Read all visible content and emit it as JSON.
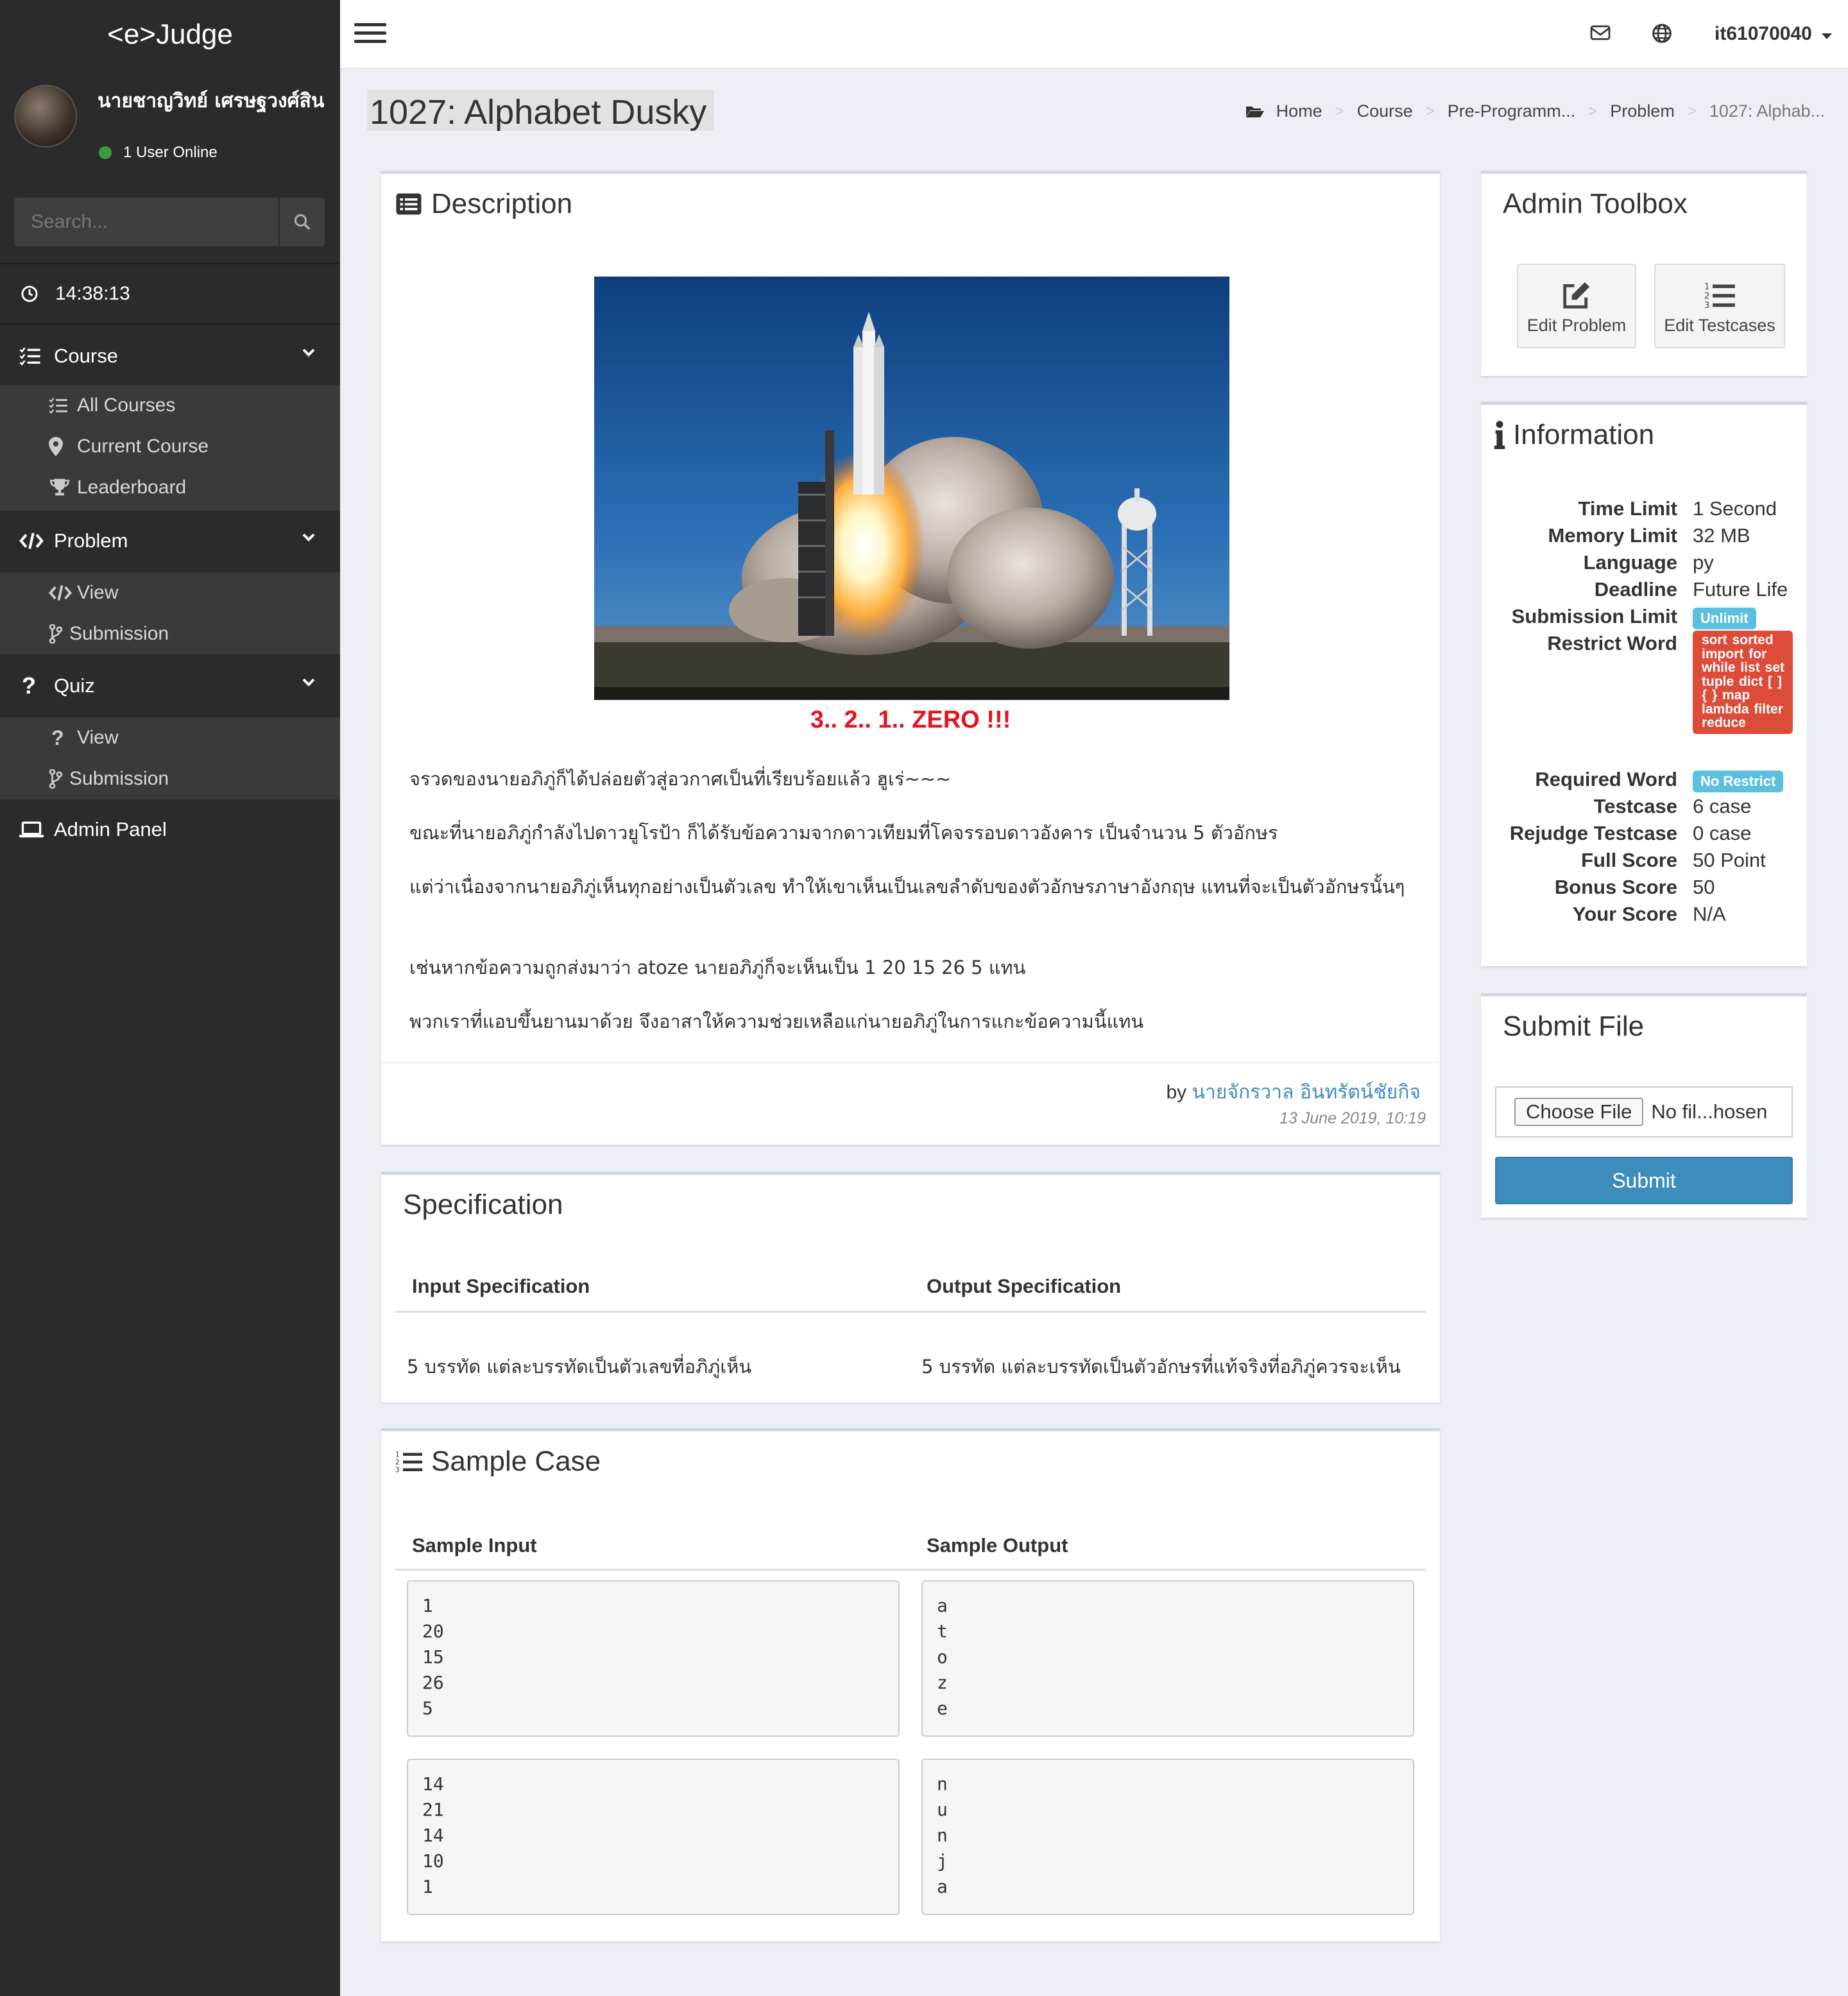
{
  "app": {
    "brand": "<e>Judge"
  },
  "user": {
    "name": "นายชาญวิทย์ เศรษฐวงศ์สิน",
    "status": "1 User Online",
    "menu_user": "it61070040"
  },
  "sidebar": {
    "search_placeholder": "Search...",
    "clock": "14:38:13",
    "course": {
      "label": "Course",
      "items": [
        "All Courses",
        "Current Course",
        "Leaderboard"
      ]
    },
    "problem": {
      "label": "Problem",
      "items": [
        "View",
        "Submission"
      ]
    },
    "quiz": {
      "label": "Quiz",
      "items": [
        "View",
        "Submission"
      ]
    },
    "admin": "Admin Panel"
  },
  "page": {
    "title": "1027: Alphabet Dusky",
    "breadcrumb": [
      "Home",
      "Course",
      "Pre-Programm...",
      "Problem",
      "1027: Alphab..."
    ]
  },
  "description": {
    "title": "Description",
    "caption": "3.. 2.. 1.. ZERO !!!",
    "paragraphs": [
      "จรวดของนายอภิภู่ก็ได้ปล่อยตัวสู่อวกาศเป็นที่เรียบร้อยแล้ว ฮูเร่~~~",
      "ขณะที่นายอภิภู่กำลังไปดาวยูโรป้า ก็ได้รับข้อความจากดาวเทียมที่โคจรรอบดาวอังคาร เป็นจำนวน 5 ตัวอักษร",
      "แต่ว่าเนื่องจากนายอภิภู่เห็นทุกอย่างเป็นตัวเลข ทำให้เขาเห็นเป็นเลขลำดับของตัวอักษรภาษาอังกฤษ แทนที่จะเป็นตัวอักษรนั้นๆ",
      "เช่นหากข้อความถูกส่งมาว่า atoze นายอภิภู่ก็จะเห็นเป็น 1 20 15 26 5 แทน",
      "พวกเราที่แอบขึ้นยานมาด้วย จึงอาสาให้ความช่วยเหลือแก่นายอภิภู่ในการแกะข้อความนี้แทน"
    ],
    "by_prefix": "by ",
    "author": "นายจักรวาล อินทรัตน์ชัยกิจ",
    "date": "13 June 2019, 10:19"
  },
  "specification": {
    "title": "Specification",
    "input_header": "Input Specification",
    "output_header": "Output Specification",
    "input": "5 บรรทัด แต่ละบรรทัดเป็นตัวเลขที่อภิภู่เห็น",
    "output": "5 บรรทัด แต่ละบรรทัดเป็นตัวอักษรที่แท้จริงที่อภิภู่ควรจะเห็น"
  },
  "sample": {
    "title": "Sample Case",
    "input_header": "Sample Input",
    "output_header": "Sample Output",
    "cases": [
      {
        "input": "1\n20\n15\n26\n5",
        "output": "a\nt\no\nz\ne"
      },
      {
        "input": "14\n21\n14\n10\n1",
        "output": "n\nu\nn\nj\na"
      }
    ]
  },
  "toolbox": {
    "title": "Admin Toolbox",
    "edit_problem": "Edit Problem",
    "edit_testcases": "Edit Testcases"
  },
  "information": {
    "title": "Information",
    "time_limit": {
      "label": "Time Limit",
      "value": "1 Second"
    },
    "memory_limit": {
      "label": "Memory Limit",
      "value": "32 MB"
    },
    "language": {
      "label": "Language",
      "value": "py"
    },
    "deadline": {
      "label": "Deadline",
      "value": "Future Life"
    },
    "submission_limit": {
      "label": "Submission Limit",
      "value": "Unlimit"
    },
    "restrict_word": {
      "label": "Restrict Word",
      "value": "sort sorted import for while list set tuple dict [ ] { } map lambda filter reduce"
    },
    "required_word": {
      "label": "Required Word",
      "value": "No Restrict"
    },
    "testcase": {
      "label": "Testcase",
      "value": "6 case"
    },
    "rejudge_testcase": {
      "label": "Rejudge Testcase",
      "value": "0 case"
    },
    "full_score": {
      "label": "Full Score",
      "value": "50 Point"
    },
    "bonus_score": {
      "label": "Bonus Score",
      "value": "50"
    },
    "your_score": {
      "label": "Your Score",
      "value": "N/A"
    }
  },
  "submit": {
    "title": "Submit File",
    "choose": "Choose File",
    "no_file": "No fil...hosen",
    "button": "Submit"
  },
  "colors": {
    "sidebar": "#2b2b2b",
    "submenu": "#3a3a3a",
    "accent": "#3c8dbc",
    "info_badge": "#5bc0de",
    "danger_badge": "#dd4b39",
    "caption_red": "#e4131e"
  }
}
